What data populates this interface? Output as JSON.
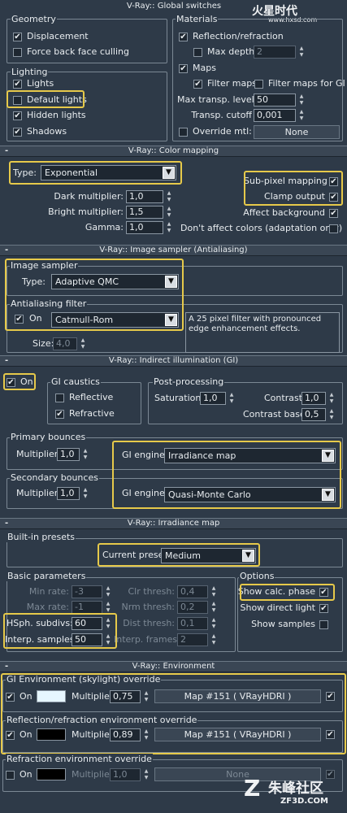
{
  "watermark_top": {
    "logo": "火星时代",
    "url": "www.hxsd.com"
  },
  "watermark_bottom": {
    "logo": "朱峰社区",
    "url": "ZF3D.COM"
  },
  "global_switches": {
    "title": "V-Ray:: Global switches",
    "geometry_label": "Geometry",
    "displacement": "Displacement",
    "force_back_face": "Force back face culling",
    "lighting_label": "Lighting",
    "lights": "Lights",
    "default_lights": "Default lights",
    "hidden_lights": "Hidden lights",
    "shadows": "Shadows",
    "materials_label": "Materials",
    "reflection_refraction": "Reflection/refraction",
    "max_depth": "Max depth",
    "max_depth_value": "2",
    "maps": "Maps",
    "filter_maps": "Filter maps",
    "filter_maps_gi": "Filter maps for GI",
    "max_transp_levels": "Max transp. levels",
    "max_transp_value": "50",
    "transp_cutoff": "Transp. cutoff",
    "transp_cutoff_value": "0,001",
    "override_mtl": "Override mtl:",
    "override_mtl_button": "None"
  },
  "color_mapping": {
    "title": "V-Ray:: Color mapping",
    "type_label": "Type:",
    "type_value": "Exponential",
    "dark_multiplier": "Dark multiplier:",
    "dark_value": "1,0",
    "bright_multiplier": "Bright multiplier:",
    "bright_value": "1,5",
    "gamma": "Gamma:",
    "gamma_value": "1,0",
    "sub_pixel": "Sub-pixel mapping",
    "clamp_output": "Clamp output",
    "affect_background": "Affect background",
    "dont_affect": "Don't affect colors (adaptation only)"
  },
  "image_sampler": {
    "title": "V-Ray:: Image sampler (Antialiasing)",
    "sampler_label": "Image sampler",
    "type_label": "Type:",
    "type_value": "Adaptive QMC",
    "aa_filter_label": "Antialiasing filter",
    "on": "On",
    "filter_value": "Catmull-Rom",
    "description": "A 25 pixel filter with pronounced edge enhancement effects.",
    "size_label": "Size:",
    "size_value": "4,0"
  },
  "indirect_illumination": {
    "title": "V-Ray:: Indirect illumination (GI)",
    "on": "On",
    "gi_caustics": "GI caustics",
    "reflective": "Reflective",
    "refractive": "Refractive",
    "post_processing": "Post-processing",
    "saturation": "Saturation:",
    "saturation_value": "1,0",
    "contrast": "Contrast:",
    "contrast_value": "1,0",
    "contrast_base": "Contrast base:",
    "contrast_base_value": "0,5",
    "primary_bounces": "Primary bounces",
    "multiplier": "Multiplier:",
    "primary_mult_value": "1,0",
    "gi_engine": "GI engine:",
    "primary_engine": "Irradiance map",
    "secondary_bounces": "Secondary bounces",
    "secondary_mult_value": "1,0",
    "secondary_engine": "Quasi-Monte Carlo"
  },
  "irradiance_map": {
    "title": "V-Ray:: Irradiance map",
    "presets_label": "Built-in presets",
    "current_preset": "Current preset:",
    "preset_value": "Medium",
    "basic_params": "Basic parameters",
    "min_rate": "Min rate:",
    "min_rate_value": "-3",
    "max_rate": "Max rate:",
    "max_rate_value": "-1",
    "hsph_subdivs": "HSph. subdivs:",
    "hsph_value": "60",
    "interp_samples": "Interp. samples:",
    "interp_value": "50",
    "clr_thresh": "Clr thresh:",
    "clr_value": "0,4",
    "nrm_thresh": "Nrm thresh:",
    "nrm_value": "0,2",
    "dist_thresh": "Dist thresh:",
    "dist_value": "0,1",
    "interp_frames": "Interp. frames:",
    "interp_frames_value": "2",
    "options": "Options",
    "show_calc": "Show calc. phase",
    "show_direct": "Show direct light",
    "show_samples": "Show samples"
  },
  "environment": {
    "title": "V-Ray:: Environment",
    "gi_override": "GI Environment (skylight) override",
    "on": "On",
    "multiplier": "Multiplier:",
    "gi_mult_value": "0,75",
    "gi_map": "Map #151  ( VRayHDRI )",
    "gi_color": "#e6f6ff",
    "refl_override": "Reflection/refraction environment override",
    "refl_mult_value": "0,89",
    "refl_map": "Map #151  ( VRayHDRI )",
    "refl_color": "#000000",
    "refr_override": "Refraction environment override",
    "refr_mult_value": "1,0",
    "refr_map": "None",
    "refr_color": "#000000"
  },
  "highlight_color": "#e6c94a"
}
